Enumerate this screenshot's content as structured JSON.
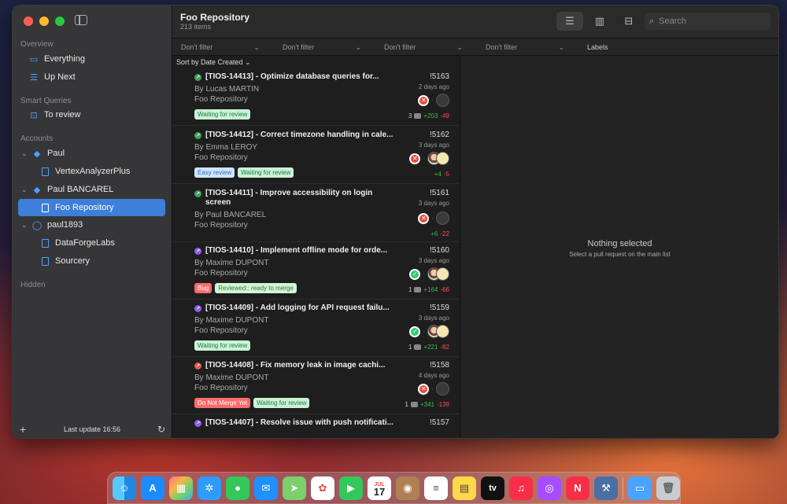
{
  "sidebar": {
    "sections": {
      "overview": "Overview",
      "smart_queries": "Smart Queries",
      "accounts": "Accounts",
      "hidden": "Hidden"
    },
    "items": {
      "everything": "Everything",
      "up_next": "Up Next",
      "to_review": "To review",
      "paul": "Paul",
      "vertex": "VertexAnalyzerPlus",
      "paul_bancarel": "Paul BANCAREL",
      "foo_repo": "Foo Repository",
      "paul1893": "paul1893",
      "dataforge": "DataForgeLabs",
      "sourcery": "Sourcery"
    },
    "footer": "Last update 16:56"
  },
  "toolbar": {
    "title": "Foo Repository",
    "count": "213 items",
    "search_placeholder": "Search"
  },
  "filters": [
    "Don't filter",
    "Don't filter",
    "Don't filter",
    "Don't filter"
  ],
  "labels_header": "Labels",
  "sort_label": "Sort by Date Created",
  "prs": [
    {
      "title": "[TIOS-14413] - Optimize database queries for...",
      "author": "By Lucas MARTIN",
      "repo": "Foo Repository",
      "num": "!5163",
      "date": "2 days ago",
      "badges": [
        "Waiting for review"
      ],
      "comments": "3",
      "add": "+203",
      "del": "-49"
    },
    {
      "title": "[TIOS-14412] - Correct timezone handling in cale...",
      "author": "By Emma LEROY",
      "repo": "Foo Repository",
      "num": "!5162",
      "date": "3 days ago",
      "badges": [
        "Easy review",
        "Waiting for review"
      ],
      "add": "+4",
      "del": "-5"
    },
    {
      "title": "[TIOS-14411] - Improve accessibility on login screen",
      "author": "By Paul BANCAREL",
      "repo": "Foo Repository",
      "num": "!5161",
      "date": "3 days ago",
      "add": "+6",
      "del": "-22"
    },
    {
      "title": "[TIOS-14410] - Implement offline mode for orde...",
      "author": "By Maxime DUPONT",
      "repo": "Foo Repository",
      "num": "!5160",
      "date": "3 days ago",
      "badges": [
        "Bug",
        "Reviewed:: ready to merge"
      ],
      "comments": "1",
      "add": "+164",
      "del": "-66"
    },
    {
      "title": "[TIOS-14409] - Add logging for API request failu...",
      "author": "By Maxime DUPONT",
      "repo": "Foo Repository",
      "num": "!5159",
      "date": "3 days ago",
      "badges": [
        "Waiting for review"
      ],
      "comments": "1",
      "add": "+221",
      "del": "-82"
    },
    {
      "title": "[TIOS-14408] - Fix memory leak in image cachi...",
      "author": "By Maxime DUPONT",
      "repo": "Foo Repository",
      "num": "!5158",
      "date": "4 days ago",
      "badges": [
        "Do Not Merge Yet",
        "Waiting for review"
      ],
      "comments": "1",
      "add": "+341",
      "del": "-139"
    },
    {
      "title": "[TIOS-14407] - Resolve issue with push notificati...",
      "num": "!5157"
    }
  ],
  "detail": {
    "title": "Nothing selected",
    "subtitle": "Select a pull request on the main list"
  },
  "dock": {
    "calendar_month": "JUL",
    "calendar_day": "17",
    "tv_label": "tv"
  }
}
